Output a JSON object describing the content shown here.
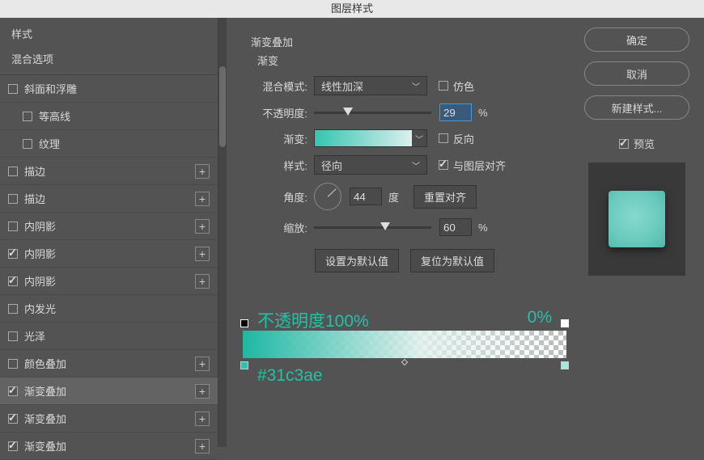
{
  "title": "图层样式",
  "sidebar": {
    "styles_header": "样式",
    "blend_header": "混合选项",
    "items": [
      {
        "label": "斜面和浮雕",
        "checked": false,
        "indent": false,
        "add": false
      },
      {
        "label": "等高线",
        "checked": false,
        "indent": true,
        "add": false
      },
      {
        "label": "纹理",
        "checked": false,
        "indent": true,
        "add": false
      },
      {
        "label": "描边",
        "checked": false,
        "indent": false,
        "add": true
      },
      {
        "label": "描边",
        "checked": false,
        "indent": false,
        "add": true
      },
      {
        "label": "内阴影",
        "checked": false,
        "indent": false,
        "add": true
      },
      {
        "label": "内阴影",
        "checked": true,
        "indent": false,
        "add": true
      },
      {
        "label": "内阴影",
        "checked": true,
        "indent": false,
        "add": true
      },
      {
        "label": "内发光",
        "checked": false,
        "indent": false,
        "add": false
      },
      {
        "label": "光泽",
        "checked": false,
        "indent": false,
        "add": false
      },
      {
        "label": "颜色叠加",
        "checked": false,
        "indent": false,
        "add": true
      },
      {
        "label": "渐变叠加",
        "checked": true,
        "indent": false,
        "add": true,
        "selected": true
      },
      {
        "label": "渐变叠加",
        "checked": true,
        "indent": false,
        "add": true
      },
      {
        "label": "渐变叠加",
        "checked": true,
        "indent": false,
        "add": true
      }
    ]
  },
  "panel": {
    "title": "渐变叠加",
    "subtitle": "渐变",
    "blend_mode_label": "混合模式:",
    "blend_mode_value": "线性加深",
    "dither_label": "仿色",
    "opacity_label": "不透明度:",
    "opacity_value": "29",
    "percent": "%",
    "gradient_label": "渐变:",
    "reverse_label": "反向",
    "style_label": "样式:",
    "style_value": "径向",
    "align_label": "与图层对齐",
    "angle_label": "角度:",
    "angle_value": "44",
    "degree": "度",
    "reset_align": "重置对齐",
    "scale_label": "缩放:",
    "scale_value": "60",
    "make_default": "设置为默认值",
    "reset_default": "复位为默认值"
  },
  "annotations": {
    "opacity_left": "不透明度100%",
    "opacity_right": "0%",
    "color_value": "#31c3ae"
  },
  "buttons": {
    "ok": "确定",
    "cancel": "取消",
    "new_style": "新建样式...",
    "preview": "预览"
  }
}
